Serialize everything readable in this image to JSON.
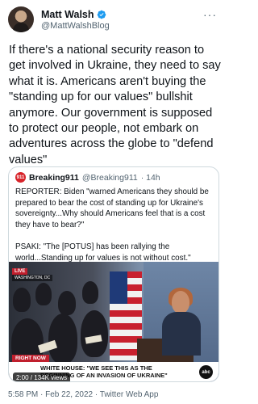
{
  "author": {
    "name": "Matt Walsh",
    "handle": "@MattWalshBlog"
  },
  "tweet": {
    "text": "If there's a national security reason to get involved in Ukraine, they need to say what it is. Americans aren't buying the \"standing up for our values\" bullshit anymore. Our government is supposed to protect our people, not embark on adventures across the globe to \"defend values\""
  },
  "quoted": {
    "avatar_text": "911",
    "name": "Breaking911",
    "handle": "@Breaking911",
    "time": "· 14h",
    "paragraph1": "REPORTER: Biden \"warned Americans they should be prepared to bear the cost of standing up for Ukraine's sovereignty...Why should Americans feel that is a cost they have to bear?\"",
    "paragraph2": "PSAKI: \"The [POTUS] has been rallying the world...Standing up for values is not without cost.\"",
    "video": {
      "live_badge": "LIVE",
      "location": "WASHINGTON, DC",
      "right_now": "RIGHT NOW",
      "headline": "WHITE HOUSE: \"WE SEE THIS AS THE BEGINNING OF AN INVASION OF UKRAINE\"",
      "views": "2:00 / 134K views",
      "network": "abc"
    }
  },
  "footer": {
    "timestamp": "5:58 PM · Feb 22, 2022 · Twitter Web App"
  },
  "colors": {
    "verified": "#1d9bf0",
    "secondary_text": "#536471",
    "border": "#cfd9de"
  }
}
